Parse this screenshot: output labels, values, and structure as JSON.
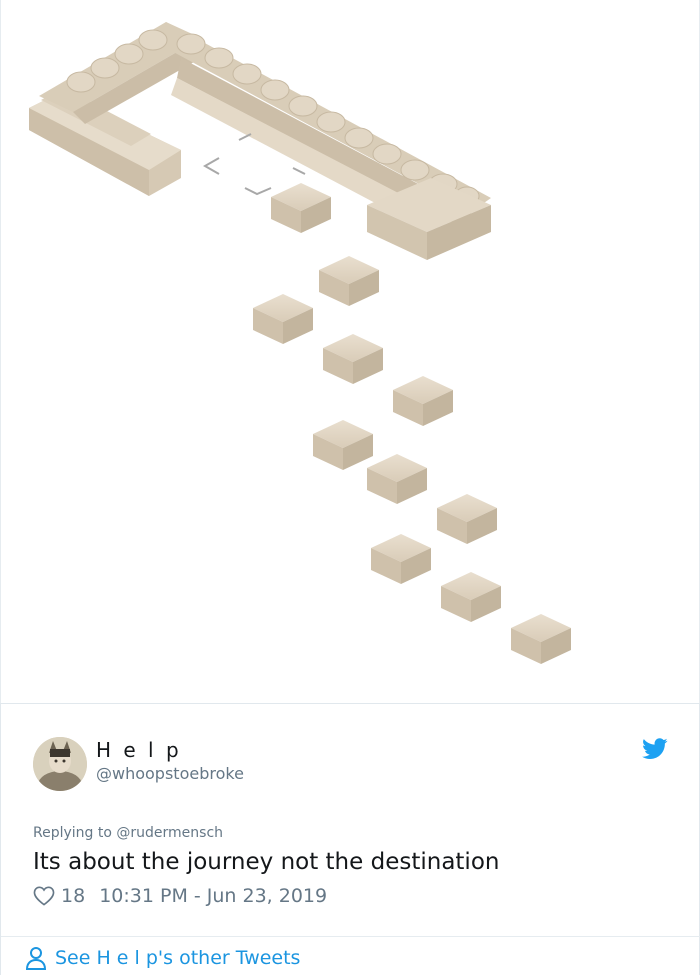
{
  "tweet": {
    "display_name": "H e l p",
    "handle": "@whoopstoebroke",
    "reply_prefix": "Replying to",
    "reply_to": "@rudermensch",
    "text": "Its about the journey not the destination",
    "like_count": "18",
    "timestamp": "10:31 PM - Jun 23, 2019",
    "see_more": "See H e l p's other Tweets"
  },
  "icons": {
    "brand": "twitter-bird-icon",
    "like": "heart-icon",
    "profile": "person-icon"
  },
  "colors": {
    "twitter_blue": "#1da1f2",
    "link_blue": "#1b95e0",
    "muted": "#657786",
    "sofa": "#ddd0bd"
  }
}
